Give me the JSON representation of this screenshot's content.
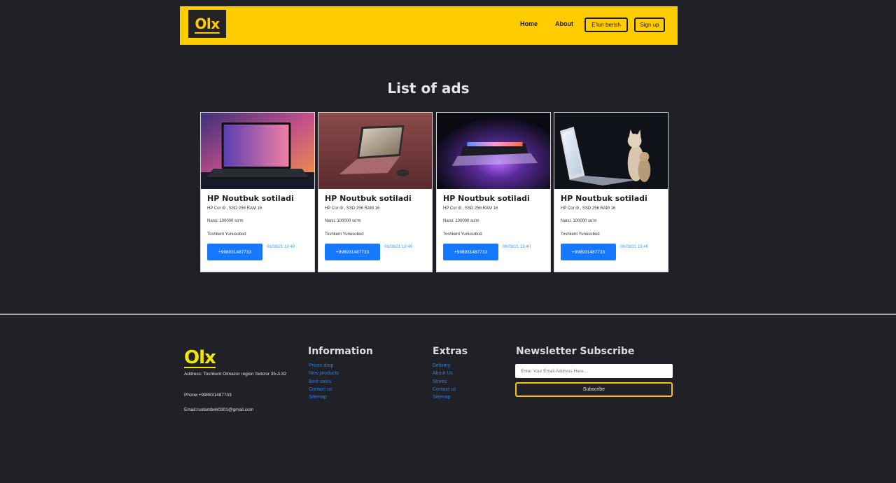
{
  "navbar": {
    "logo": "Olx",
    "links": [
      "Home",
      "About"
    ],
    "buttons": [
      "E'lon berish",
      "Sign up"
    ]
  },
  "page_title": "List of ads",
  "ads": [
    {
      "title": "HP Noutbuk sotiladi",
      "desc": "HP Cor i9 , SSD 256 RAM 16",
      "price": "Narxi: 100000 so'm",
      "location": "Toshkent Yunusobod",
      "phone": "+998931487733",
      "date": "06/09/21 19:40"
    },
    {
      "title": "HP Noutbuk sotiladi",
      "desc": "HP Cor i9 , SSD 256 RAM 16",
      "price": "Narxi: 100000 so'm",
      "location": "Toshkent Yunusobod",
      "phone": "+998931487733",
      "date": "06/09/21 19:40"
    },
    {
      "title": "HP Noutbuk sotiladi",
      "desc": "HP Cor i9 , SSD 256 RAM 16",
      "price": "Narxi: 100000 so'm",
      "location": "Toshkent Yunusobod",
      "phone": "+998931487733",
      "date": "06/09/21 19:40"
    },
    {
      "title": "HP Noutbuk sotiladi",
      "desc": "HP Cor i9 , SSD 256 RAM 16",
      "price": "Narxi: 100000 so'm",
      "location": "Toshkent Yunusobod",
      "phone": "+998931487733",
      "date": "06/09/21 19:40"
    }
  ],
  "footer": {
    "logo": "Olx",
    "address": "Address: Toshkent Olmazor region Sebzor 35-A 82",
    "phone": "Phone:+998931487733",
    "email": "Email:rustambek0301@gmail.com",
    "information": {
      "title": "Information",
      "links": [
        "Prices drop",
        "New products",
        "Best sales",
        "Contact us",
        "Sitemap"
      ]
    },
    "extras": {
      "title": "Extras",
      "links": [
        "Delivery",
        "About Us",
        "Stores",
        "Contact us",
        "Sitemap"
      ]
    },
    "newsletter": {
      "title": "Newsletter Subscribe",
      "placeholder": "Enter Your Email Address Here...",
      "button": "Subscribe"
    }
  },
  "colors": {
    "background": "#1f2126",
    "brand_yellow": "#ffcc00",
    "primary_blue": "#1677ff",
    "link_blue": "#2f7de6"
  }
}
